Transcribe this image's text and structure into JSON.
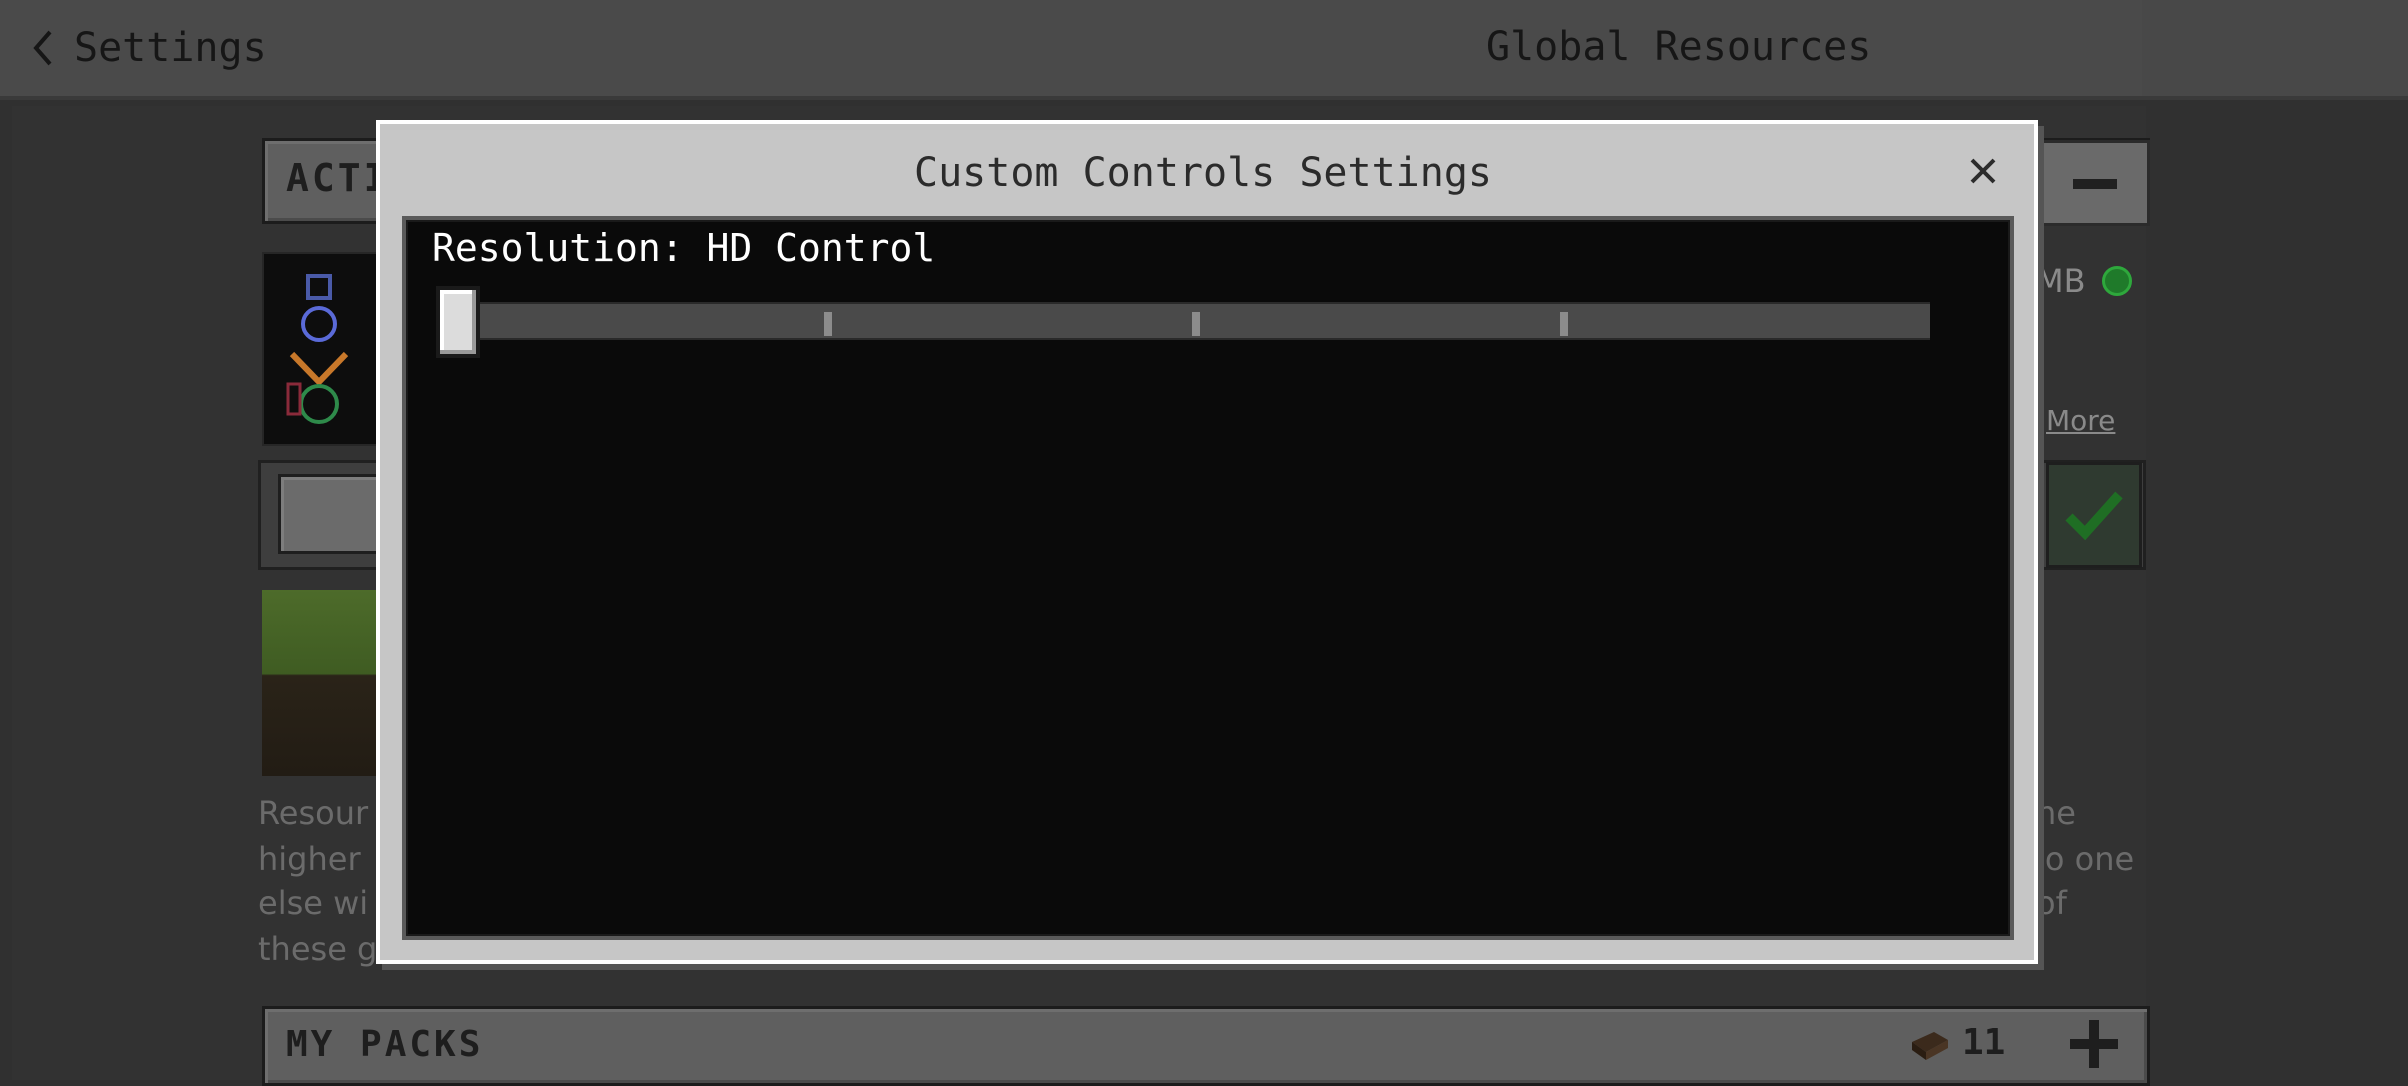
{
  "header": {
    "back_label": "Settings",
    "title": "Global Resources"
  },
  "background": {
    "active_section_label": "ACTI",
    "pack_size_fragment": "MB",
    "more_link": "More",
    "description_left": [
      "Resour",
      "higher",
      "else wi",
      "these g"
    ],
    "description_right": [
      "ne",
      "lo one",
      "of"
    ],
    "my_packs_label": "MY PACKS",
    "my_packs_count": "11",
    "status_color": "#2ea83c"
  },
  "modal": {
    "title": "Custom Controls Settings",
    "close_icon": "close-icon",
    "setting_label": "Resolution: HD Control",
    "slider": {
      "value": 0,
      "steps": 5
    }
  },
  "icons": {
    "back": "chevron-left-icon",
    "collapse": "minus-icon",
    "confirm": "checkmark-icon",
    "add": "plus-icon",
    "packs": "book-icon"
  }
}
